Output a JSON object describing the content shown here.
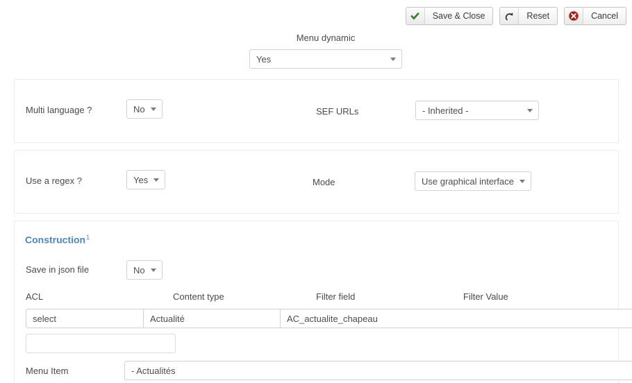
{
  "toolbar": {
    "buttons": [
      {
        "id": "save-close",
        "label": "Save & Close",
        "icon": "check-icon",
        "icon_color": "#3a7d2c"
      },
      {
        "id": "reset",
        "label": "Reset",
        "icon": "redo-arrow-icon",
        "icon_color": "#333333"
      },
      {
        "id": "cancel",
        "label": "Cancel",
        "icon": "cancel-circle-icon",
        "icon_color": "#9b2020"
      }
    ]
  },
  "top_field": {
    "label": "Menu dynamic",
    "value": "Yes"
  },
  "panel_multilanguage": {
    "multi_language": {
      "label": "Multi language ?",
      "value": "No"
    },
    "sef_urls": {
      "label": "SEF URLs",
      "value": "- Inherited -"
    }
  },
  "panel_regex": {
    "use_regex": {
      "label": "Use a regex ?",
      "value": "Yes"
    },
    "mode": {
      "label": "Mode",
      "value": "Use graphical interface"
    }
  },
  "panel_construction": {
    "title": "Construction",
    "title_superscript": "1",
    "title_color": "#4f86b8",
    "save_json": {
      "label": "Save in json file",
      "value": "No"
    },
    "table": {
      "headers": [
        "ACL",
        "Content type",
        "Filter field",
        "Filter Value"
      ],
      "row": {
        "acl": "select",
        "content_type": "Actualité",
        "filter_field": "AC_actualite_chapeau",
        "filter_value": ""
      }
    },
    "filter_value_input": {
      "value": "",
      "placeholder": ""
    },
    "menu_item": {
      "label": "Menu Item",
      "value": "- Actualités"
    }
  }
}
